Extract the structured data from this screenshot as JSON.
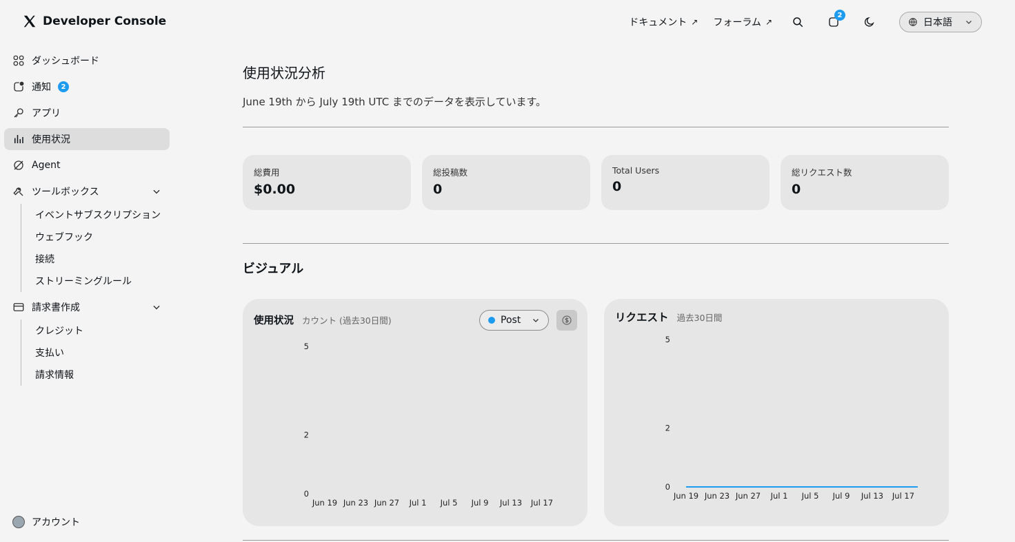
{
  "header": {
    "brand": "Developer Console",
    "links": [
      {
        "label": "ドキュメント",
        "arrow": "↗"
      },
      {
        "label": "フォーラム",
        "arrow": "↗"
      }
    ],
    "notification_count": "2",
    "language": "日本語"
  },
  "sidebar": {
    "items": [
      {
        "label": "ダッシュボード",
        "icon": "dashboard-icon"
      },
      {
        "label": "通知",
        "icon": "notification-icon",
        "badge": "2"
      },
      {
        "label": "アプリ",
        "icon": "key-icon"
      },
      {
        "label": "使用状況",
        "icon": "bar-chart-icon",
        "active": true
      },
      {
        "label": "Agent",
        "icon": "agent-icon"
      },
      {
        "label": "ツールボックス",
        "icon": "wrench-icon"
      },
      {
        "label": "請求書作成",
        "icon": "credit-card-icon"
      }
    ],
    "toolbox_sub": [
      "イベントサブスクリプション",
      "ウェブフック",
      "接続",
      "ストリーミングルール"
    ],
    "billing_sub": [
      "クレジット",
      "支払い",
      "請求情報"
    ],
    "account": "アカウント"
  },
  "main": {
    "title": "使用状況分析",
    "subtitle": "June 19th から July 19th UTC までのデータを表示しています。",
    "stats": [
      {
        "label": "総費用",
        "value": "$0.00"
      },
      {
        "label": "総投稿数",
        "value": "0"
      },
      {
        "label": "Total Users",
        "value": "0"
      },
      {
        "label": "総リクエスト数",
        "value": "0"
      }
    ],
    "visual_title": "ビジュアル",
    "usage_card": {
      "title": "使用状況",
      "subtitle": "カウント (過去30日間)",
      "select": "Post"
    },
    "request_card": {
      "title": "リクエスト",
      "subtitle": "過去30日間"
    }
  },
  "colors": {
    "accent": "#1d9bf0",
    "background": "#f4f4f4",
    "card": "#e6e6e6"
  },
  "chart_data": [
    {
      "type": "bar",
      "title": "使用状況",
      "subtitle": "カウント (過去30日間)",
      "categories": [
        "Jun 19",
        "Jun 23",
        "Jun 27",
        "Jul 1",
        "Jul 5",
        "Jul 9",
        "Jul 13",
        "Jul 17"
      ],
      "y_ticks": [
        0,
        2,
        5
      ],
      "ylim": [
        0,
        5
      ],
      "series": [
        {
          "name": "Post",
          "values": [
            0,
            0,
            0,
            0,
            0,
            0,
            0,
            0
          ]
        }
      ]
    },
    {
      "type": "line",
      "title": "リクエスト",
      "subtitle": "過去30日間",
      "categories": [
        "Jun 19",
        "Jun 23",
        "Jun 27",
        "Jul 1",
        "Jul 5",
        "Jul 9",
        "Jul 13",
        "Jul 17"
      ],
      "y_ticks": [
        0,
        2,
        5
      ],
      "ylim": [
        0,
        5
      ],
      "series": [
        {
          "values": [
            0,
            0,
            0,
            0,
            0,
            0,
            0,
            0
          ]
        }
      ]
    }
  ]
}
